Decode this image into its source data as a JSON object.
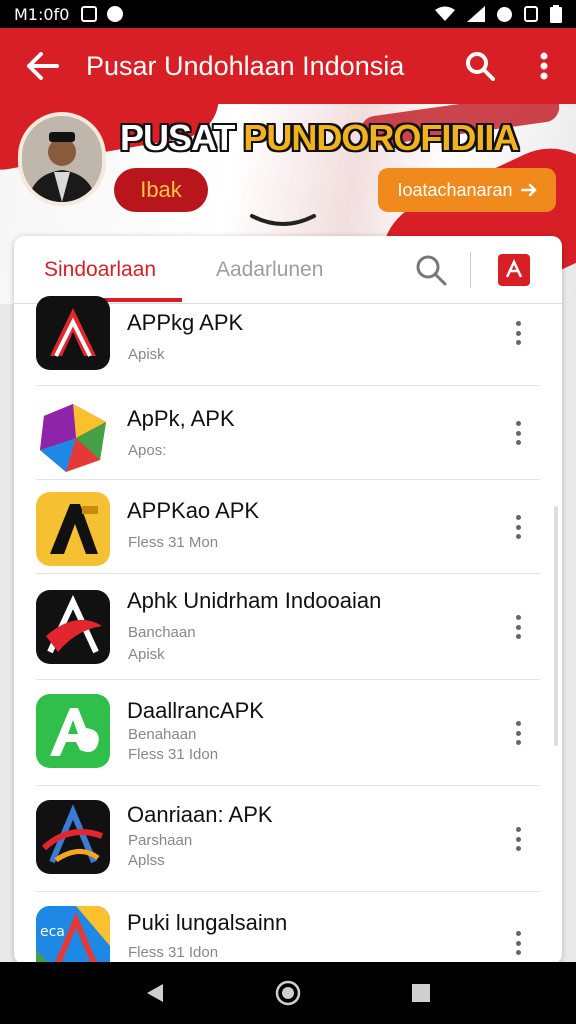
{
  "status_bar": {
    "time": "M1:0f0",
    "icons_left": [
      "photo-icon",
      "chat-icon"
    ],
    "icons_right": [
      "wifi-icon",
      "signal-icon",
      "alarm-icon",
      "sim-icon",
      "battery-icon"
    ]
  },
  "app_bar": {
    "title": "Pusar Undohlaan Indonsia",
    "back_icon": "arrow-back-icon",
    "search_icon": "search-icon",
    "menu_icon": "more-vert-icon"
  },
  "banner": {
    "headline_white": "PUSAT ",
    "headline_gold": "PUNDOROFIDIIA",
    "left_pill": "Ibak",
    "right_pill": "Ioatachanaran",
    "right_pill_icon": "arrow-right-icon"
  },
  "tabs": {
    "active": "Sindoarlaan",
    "inactive": "Aadarlunen"
  },
  "apps": [
    {
      "name": "APPkg APK",
      "line1": "Apisk",
      "line2": ""
    },
    {
      "name": "ApPk, APK",
      "line1": "Apos:",
      "line2": ""
    },
    {
      "name": "APPKao APK",
      "line1": "Fless 31 Mon",
      "line2": ""
    },
    {
      "name": "Aphk Unidrham Indooaian",
      "line1": "Banchaan",
      "line2": "Apisk"
    },
    {
      "name": "DaallrancAPK",
      "line1": "Benahaan",
      "line2": "Fless 31 Idon"
    },
    {
      "name": "Oanriaan: APK",
      "line1": "Parshaan",
      "line2": "Aplss"
    },
    {
      "name": "Puki lungalsainn",
      "line1": "Fless 31 Idon",
      "line2": ""
    }
  ],
  "colors": {
    "brand_red": "#d81f26",
    "accent_orange": "#f08a1c",
    "gold": "#f0b21e"
  },
  "nav": {
    "back": "nav-back-icon",
    "home": "nav-home-icon",
    "recents": "nav-recents-icon"
  }
}
